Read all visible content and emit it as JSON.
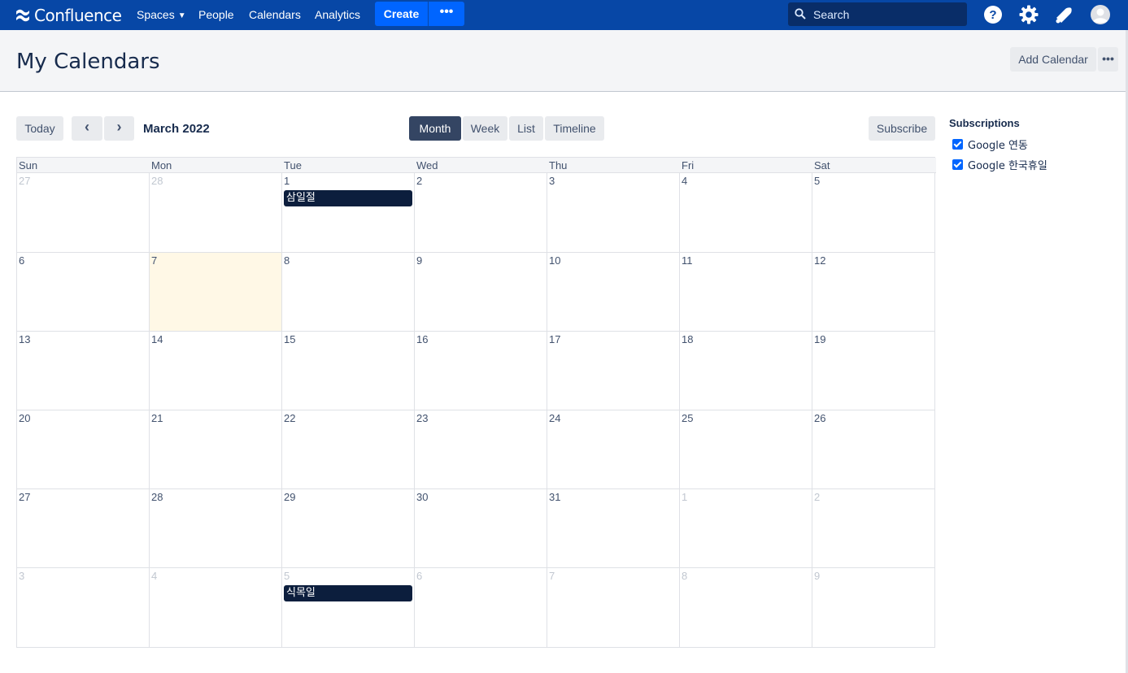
{
  "topnav": {
    "brand": "Confluence",
    "items": [
      {
        "label": "Spaces",
        "has_dropdown": true
      },
      {
        "label": "People"
      },
      {
        "label": "Calendars"
      },
      {
        "label": "Analytics"
      }
    ],
    "create_label": "Create",
    "more_label": "•••",
    "search_placeholder": "Search",
    "icons": [
      "help-icon",
      "settings-icon",
      "notifications-icon",
      "avatar"
    ]
  },
  "header": {
    "title": "My Calendars",
    "add_calendar_label": "Add Calendar",
    "more_label": "•••"
  },
  "toolbar": {
    "today_label": "Today",
    "prev_label": "‹",
    "next_label": "›",
    "month_label": "March 2022",
    "views": [
      "Month",
      "Week",
      "List",
      "Timeline"
    ],
    "active_view": "Month",
    "subscribe_label": "Subscribe"
  },
  "calendar": {
    "weekdays": [
      "Sun",
      "Mon",
      "Tue",
      "Wed",
      "Thu",
      "Fri",
      "Sat"
    ],
    "weeks": [
      [
        "27",
        "28",
        "1",
        "2",
        "3",
        "4",
        "5"
      ],
      [
        "6",
        "7",
        "8",
        "9",
        "10",
        "11",
        "12"
      ],
      [
        "13",
        "14",
        "15",
        "16",
        "17",
        "18",
        "19"
      ],
      [
        "20",
        "21",
        "22",
        "23",
        "24",
        "25",
        "26"
      ],
      [
        "27",
        "28",
        "29",
        "30",
        "31",
        "1",
        "2"
      ],
      [
        "3",
        "4",
        "5",
        "6",
        "7",
        "8",
        "9"
      ]
    ],
    "events": [
      {
        "title": "삼일절"
      },
      {
        "title": "식목일"
      }
    ]
  },
  "subscriptions": {
    "title": "Subscriptions",
    "items": [
      {
        "label": "Google 연동",
        "checked": true
      },
      {
        "label": "Google 한국휴일",
        "checked": true
      }
    ]
  },
  "colors": {
    "nav_bg": "#0747a6",
    "create_btn": "#0065ff",
    "event_bg": "#0c1e3d",
    "today_bg": "#fff8e6",
    "active_view_bg": "#344563"
  }
}
